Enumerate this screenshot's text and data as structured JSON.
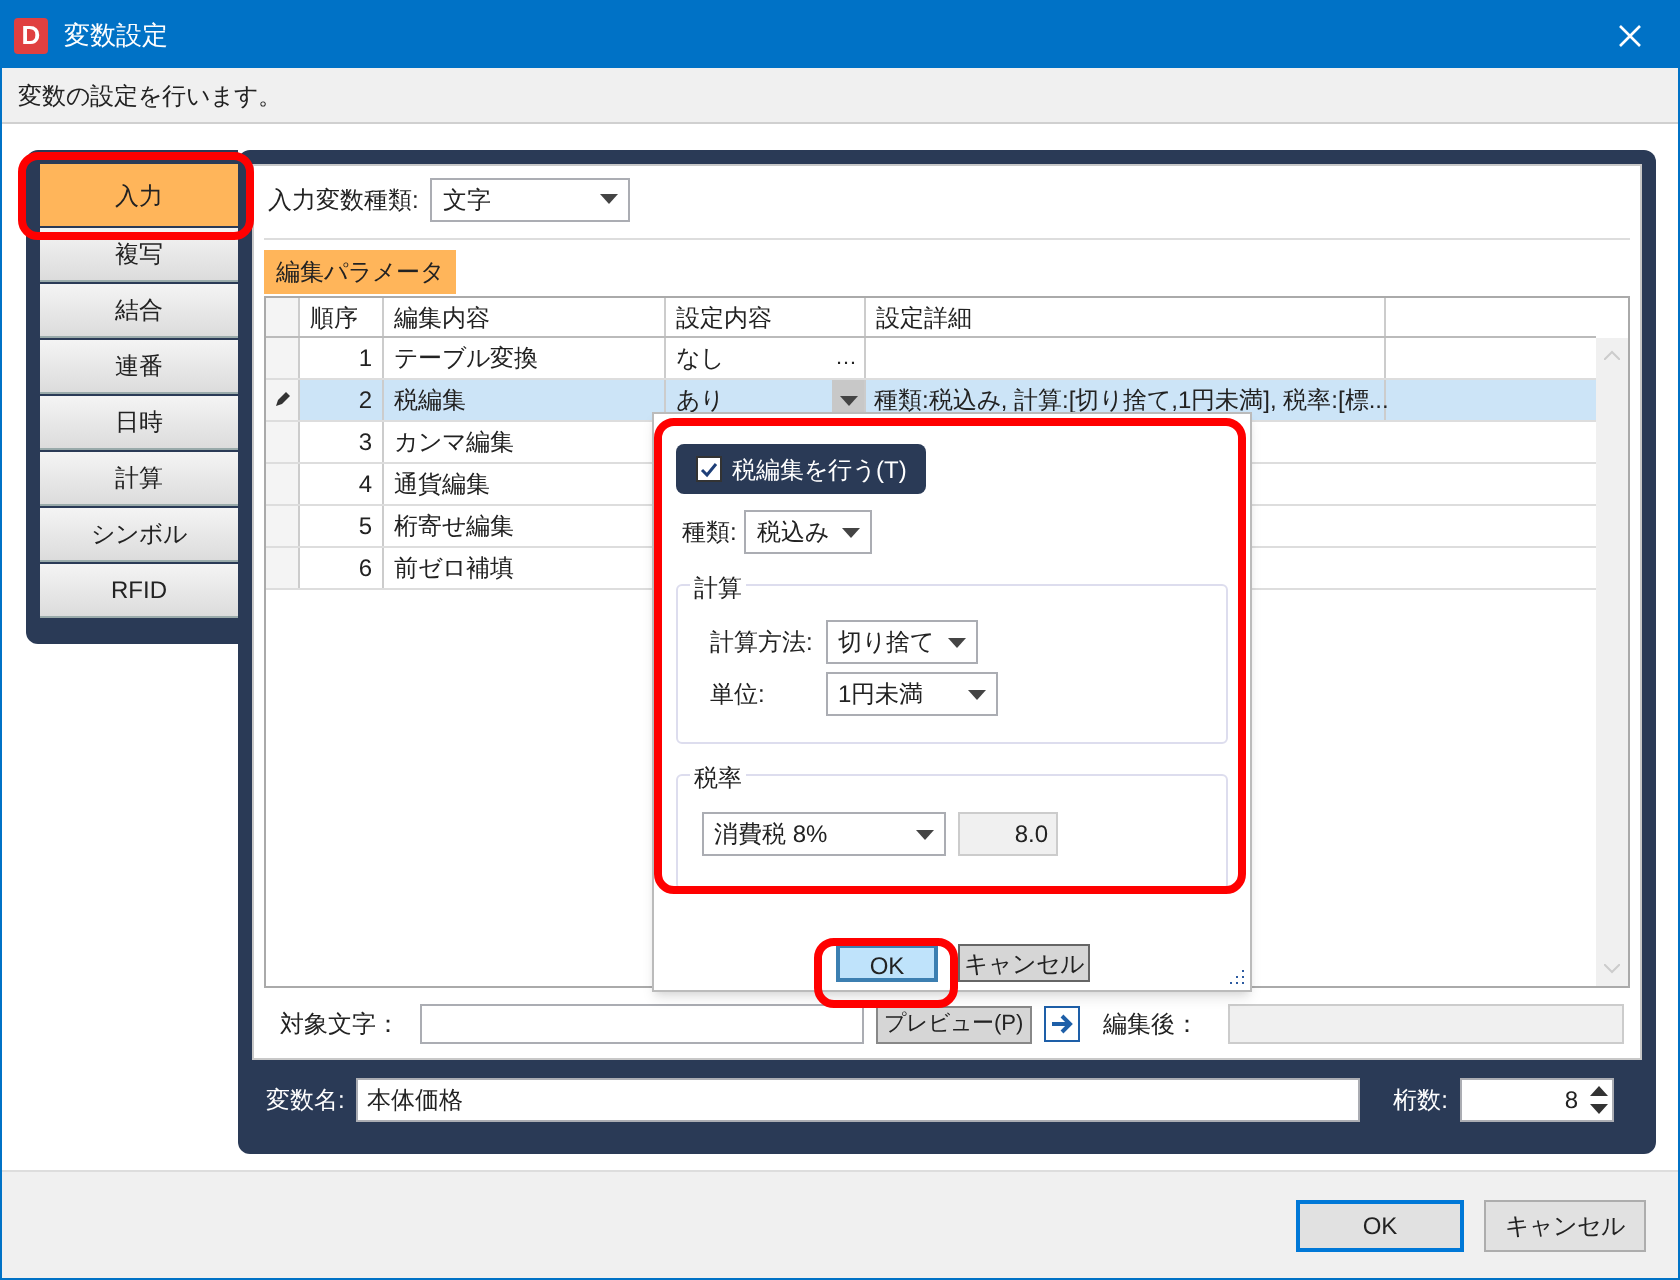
{
  "window": {
    "title": "変数設定",
    "app_icon": "D"
  },
  "description": "変数の設定を行います。",
  "side_tabs": [
    {
      "label": "入力",
      "selected": true,
      "highlighted": true
    },
    {
      "label": "複写",
      "selected": false,
      "highlighted": false
    },
    {
      "label": "結合",
      "selected": false,
      "highlighted": false
    },
    {
      "label": "連番",
      "selected": false,
      "highlighted": false
    },
    {
      "label": "日時",
      "selected": false,
      "highlighted": false
    },
    {
      "label": "計算",
      "selected": false,
      "highlighted": false
    },
    {
      "label": "シンボル",
      "selected": false,
      "highlighted": false
    },
    {
      "label": "RFID",
      "selected": false,
      "highlighted": false
    }
  ],
  "input_type": {
    "label": "入力変数種類:",
    "value": "文字"
  },
  "grid_tab": {
    "label": "編集パラメータ",
    "selected": true
  },
  "table": {
    "columns": [
      "順序",
      "編集内容",
      "設定内容",
      "設定詳細"
    ],
    "rows": [
      {
        "order": "1",
        "item": "テーブル変換",
        "setting": "なし",
        "kind": "ellipsis",
        "button": "…",
        "selected": false,
        "editing": false
      },
      {
        "order": "2",
        "item": "税編集",
        "setting": "あり",
        "kind": "dropdown",
        "detail": "種類:税込み, 計算:[切り捨て,1円未満], 税率:[標...",
        "selected": true,
        "editing": true
      },
      {
        "order": "3",
        "item": "カンマ編集",
        "selected": false,
        "editing": false
      },
      {
        "order": "4",
        "item": "通貨編集",
        "selected": false,
        "editing": false
      },
      {
        "order": "5",
        "item": "桁寄せ編集",
        "selected": false,
        "editing": false
      },
      {
        "order": "6",
        "item": "前ゼロ補填",
        "selected": false,
        "editing": false
      }
    ]
  },
  "popup": {
    "highlighted": true,
    "checkbox": {
      "label": "税編集を行う(T)",
      "checked": true
    },
    "type": {
      "label": "種類:",
      "value": "税込み"
    },
    "calc_group": {
      "title": "計算",
      "method": {
        "label": "計算方法:",
        "value": "切り捨て"
      },
      "unit": {
        "label": "単位:",
        "value": "1円未満"
      }
    },
    "rate_group": {
      "title": "税率",
      "select": "消費税 8%",
      "value": "8.0"
    },
    "ok": {
      "label": "OK",
      "highlighted": true
    },
    "cancel": "キャンセル"
  },
  "preview": {
    "target_label": "対象文字：",
    "preview_button": "プレビュー(P)",
    "after_label": "編集後："
  },
  "variable": {
    "name_label": "変数名:",
    "name_value": "本体価格",
    "digits_label": "桁数:",
    "digits_value": "8"
  },
  "footer": {
    "ok": "OK",
    "cancel": "キャンセル"
  }
}
